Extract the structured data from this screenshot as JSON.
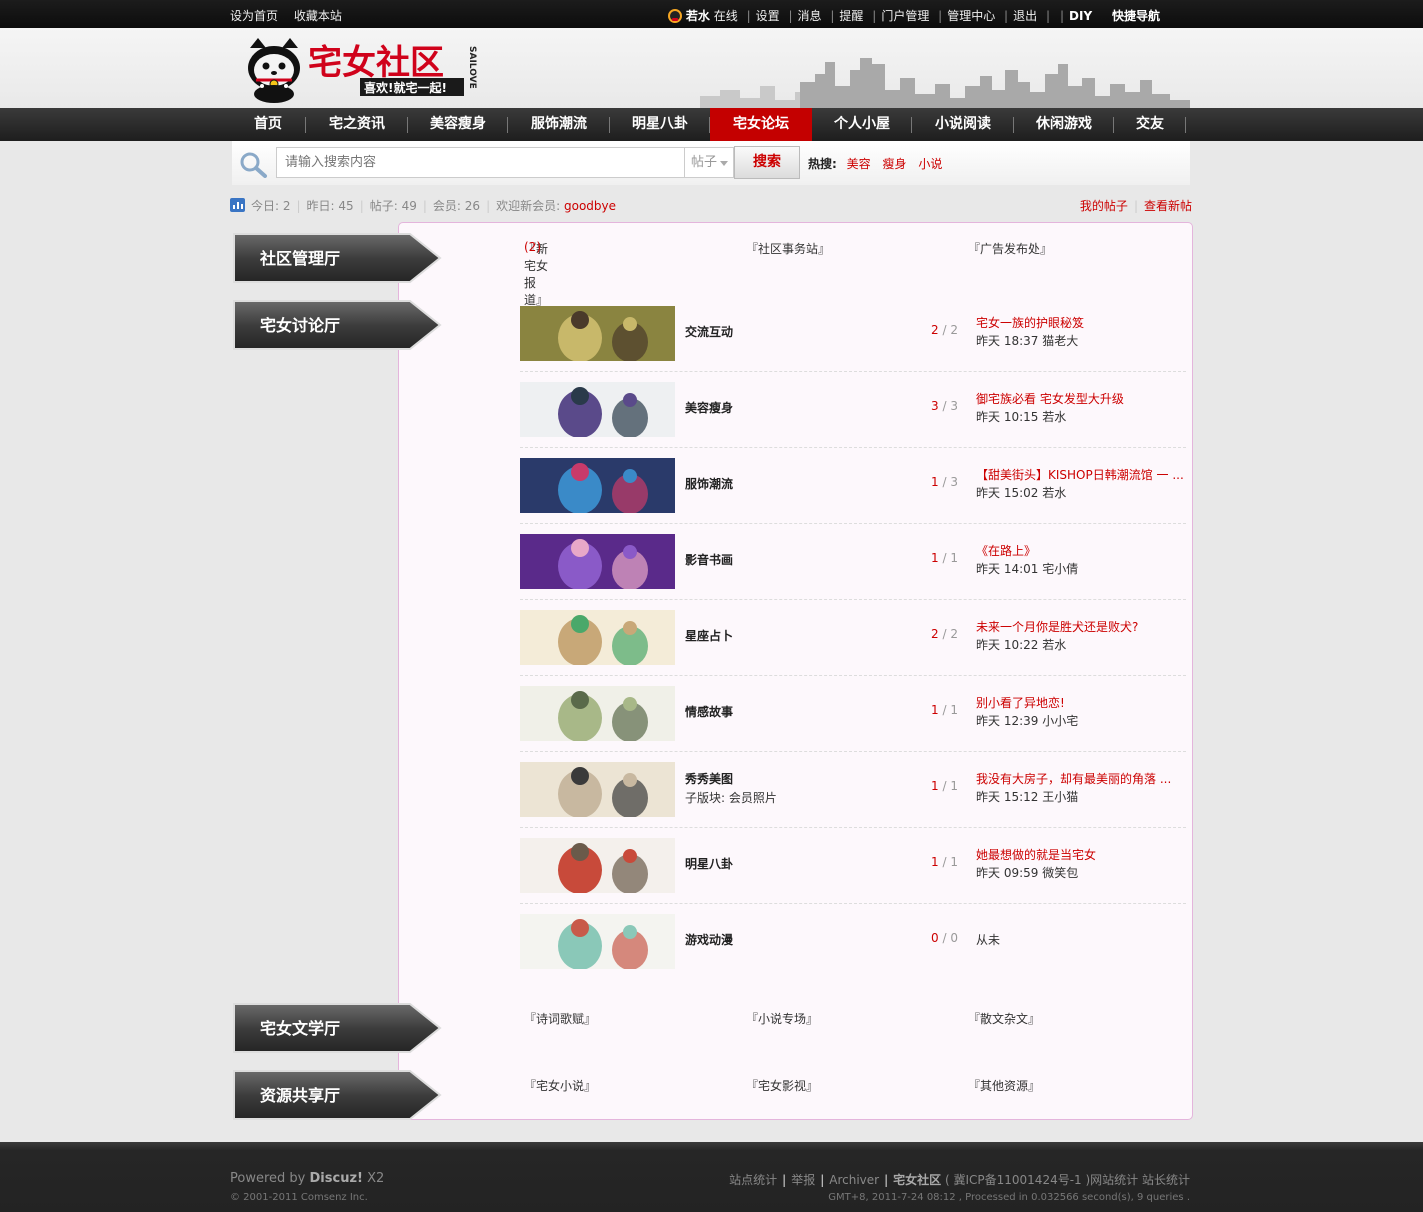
{
  "topbar": {
    "left": [
      "设为首页",
      "收藏本站"
    ],
    "username": "若水",
    "status": "在线",
    "links": [
      "设置",
      "消息",
      "提醒",
      "门户管理",
      "管理中心",
      "退出"
    ],
    "diy": "DIY",
    "quick_nav": "快捷导航"
  },
  "header": {
    "logo_text": "宅女社区",
    "logo_slogan": "喜欢!就宅一起!",
    "logo_side": "SAILOVE"
  },
  "nav": [
    {
      "label": "首页",
      "active": false
    },
    {
      "label": "宅之资讯",
      "active": false
    },
    {
      "label": "美容瘦身",
      "active": false
    },
    {
      "label": "服饰潮流",
      "active": false
    },
    {
      "label": "明星八卦",
      "active": false
    },
    {
      "label": "宅女论坛",
      "active": true
    },
    {
      "label": "个人小屋",
      "active": false
    },
    {
      "label": "小说阅读",
      "active": false
    },
    {
      "label": "休闲游戏",
      "active": false
    },
    {
      "label": "交友",
      "active": false
    }
  ],
  "search": {
    "placeholder": "请输入搜索内容",
    "type": "帖子",
    "button": "搜索",
    "hot_label": "热搜:",
    "hot": [
      "美容",
      "瘦身",
      "小说"
    ]
  },
  "stats": {
    "today": "今日: 2",
    "yesterday": "昨日: 45",
    "posts": "帖子: 49",
    "members": "会员: 26",
    "welcome": "欢迎新会员:",
    "newest_member": "goodbye",
    "my_posts": "我的帖子",
    "new_posts": "查看新帖"
  },
  "categories": [
    {
      "name": "社区管理厅",
      "subs": [
        "『新宅女报道』",
        "『社区事务站』",
        "『广告发布处』"
      ],
      "sub_count": "(2)"
    },
    {
      "name": "宅女讨论厅"
    },
    {
      "name": "宅女文学厅",
      "subs": [
        "『诗词歌赋』",
        "『小说专场』",
        "『散文杂文』"
      ]
    },
    {
      "name": "资源共享厅",
      "subs": [
        "『宅女小说』",
        "『宅女影视』",
        "『其他资源』"
      ]
    }
  ],
  "forums": [
    {
      "name": "交流互动",
      "threads": "2",
      "posts": "2",
      "last_title": "宅女一族的护眼秘笈",
      "last_meta": "昨天 18:37 猫老大"
    },
    {
      "name": "美容瘦身",
      "threads": "3",
      "posts": "3",
      "last_title": "御宅族必看 宅女发型大升级",
      "last_meta": "昨天 10:15 若水"
    },
    {
      "name": "服饰潮流",
      "threads": "1",
      "posts": "3",
      "last_title": "【甜美街头】KISHOP日韩潮流馆 一 ...",
      "last_meta": "昨天 15:02 若水"
    },
    {
      "name": "影音书画",
      "threads": "1",
      "posts": "1",
      "last_title": "《在路上》",
      "last_meta": "昨天 14:01 宅小倩"
    },
    {
      "name": "星座占卜",
      "threads": "2",
      "posts": "2",
      "last_title": "未来一个月你是胜犬还是败犬?",
      "last_meta": "昨天 10:22 若水"
    },
    {
      "name": "情感故事",
      "threads": "1",
      "posts": "1",
      "last_title": "别小看了异地恋!",
      "last_meta": "昨天 12:39 小小宅"
    },
    {
      "name": "秀秀美图",
      "sub": "子版块: 会员照片",
      "threads": "1",
      "posts": "1",
      "last_title": "我没有大房子，却有最美丽的角落 ...",
      "last_meta": "昨天 15:12 王小猫"
    },
    {
      "name": "明星八卦",
      "threads": "1",
      "posts": "1",
      "last_title": "她最想做的就是当宅女",
      "last_meta": "昨天 09:59 微笑包"
    },
    {
      "name": "游戏动漫",
      "threads": "0",
      "posts": "0",
      "never": "从未"
    }
  ],
  "footer": {
    "powered_by": "Powered by",
    "product": "Discuz!",
    "version": "X2",
    "copyright": "© 2001-2011 Comsenz Inc.",
    "links": [
      "站点统计",
      "举报",
      "Archiver"
    ],
    "site_name": "宅女社区",
    "icp": "( 冀ICP备11001424号-1 )网站统计 站长统计",
    "debug": "GMT+8, 2011-7-24 08:12 , Processed in 0.032566 second(s), 9 queries ."
  },
  "colors": {
    "accent": "#c40000",
    "link": "#cc0000",
    "panel_border": "#e4b5dc",
    "panel_bg": "#fdf8fc"
  }
}
